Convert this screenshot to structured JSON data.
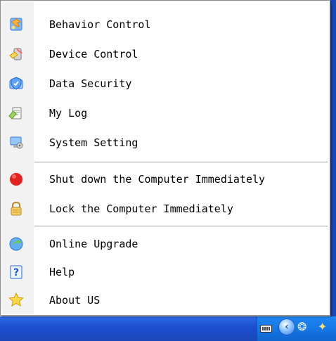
{
  "menu": {
    "items": [
      {
        "label": "Behavior Control",
        "icon": "behavior-control-icon"
      },
      {
        "label": "Device Control",
        "icon": "device-control-icon"
      },
      {
        "label": "Data Security",
        "icon": "data-security-icon"
      },
      {
        "label": "My Log",
        "icon": "my-log-icon"
      },
      {
        "label": "System Setting",
        "icon": "system-setting-icon"
      },
      {
        "label": "Shut down the Computer Immediately",
        "icon": "red-stop-icon"
      },
      {
        "label": "Lock the Computer Immediately",
        "icon": "lock-icon"
      },
      {
        "label": "Online Upgrade",
        "icon": "online-upgrade-icon"
      },
      {
        "label": "Help",
        "icon": "help-icon"
      },
      {
        "label": "About US",
        "icon": "star-icon"
      }
    ]
  },
  "colors": {
    "menu_background": "#ffffff",
    "icon_column": "#f2f2f2",
    "separator": "#a0a0a0",
    "taskbar_blue": "#1a47b8",
    "tray_blue": "#1477e6"
  }
}
